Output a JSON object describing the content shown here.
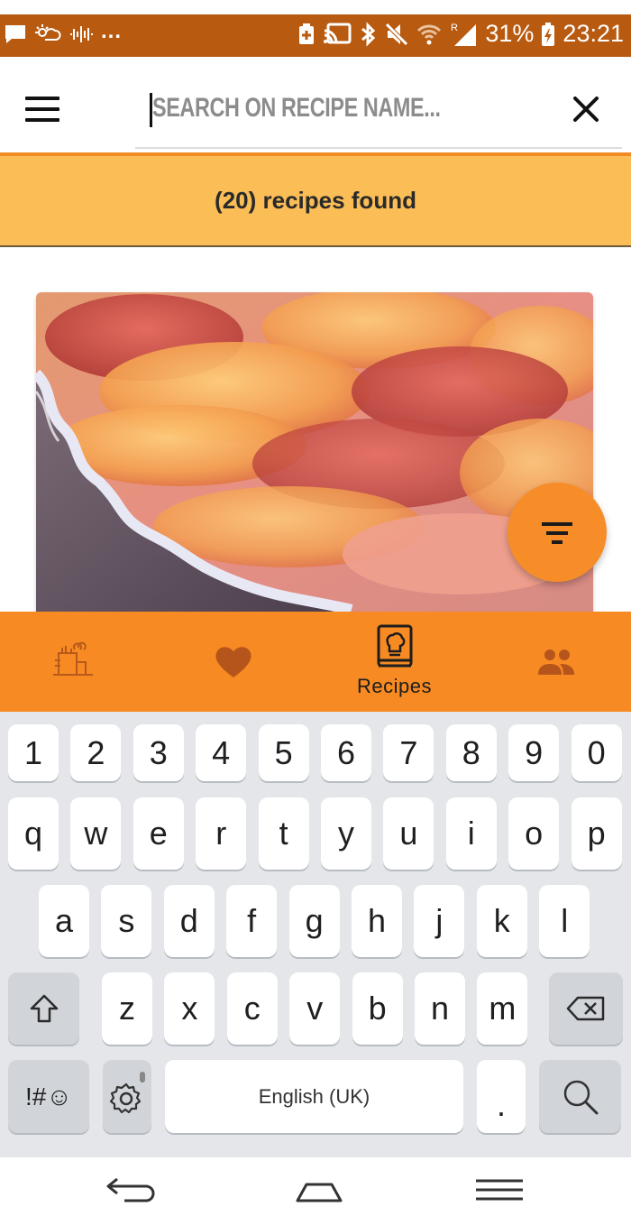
{
  "status_bar": {
    "battery": "31%",
    "time": "23:21",
    "overflow": "..."
  },
  "search": {
    "placeholder": "SEARCH ON RECIPE NAME...",
    "value": ""
  },
  "results": {
    "summary": "(20) recipes found"
  },
  "bottom_nav": {
    "items": [
      {
        "icon": "pantry-icon",
        "label": ""
      },
      {
        "icon": "heart-icon",
        "label": ""
      },
      {
        "icon": "recipe-book-icon",
        "label": "Recipes",
        "active": true
      },
      {
        "icon": "people-icon",
        "label": ""
      }
    ]
  },
  "keyboard": {
    "row_numbers": [
      "1",
      "2",
      "3",
      "4",
      "5",
      "6",
      "7",
      "8",
      "9",
      "0"
    ],
    "row_top": [
      "q",
      "w",
      "e",
      "r",
      "t",
      "y",
      "u",
      "i",
      "o",
      "p"
    ],
    "row_middle": [
      "a",
      "s",
      "d",
      "f",
      "g",
      "h",
      "j",
      "k",
      "l"
    ],
    "row_bottom": [
      "z",
      "x",
      "c",
      "v",
      "b",
      "n",
      "m"
    ],
    "symbols_label": "!#☺",
    "space_label": "English (UK)",
    "period_label": "."
  },
  "colors": {
    "status_bar": "#b85a10",
    "banner": "#fbbd56",
    "accent": "#f78a22",
    "fab": "#f78d28"
  }
}
